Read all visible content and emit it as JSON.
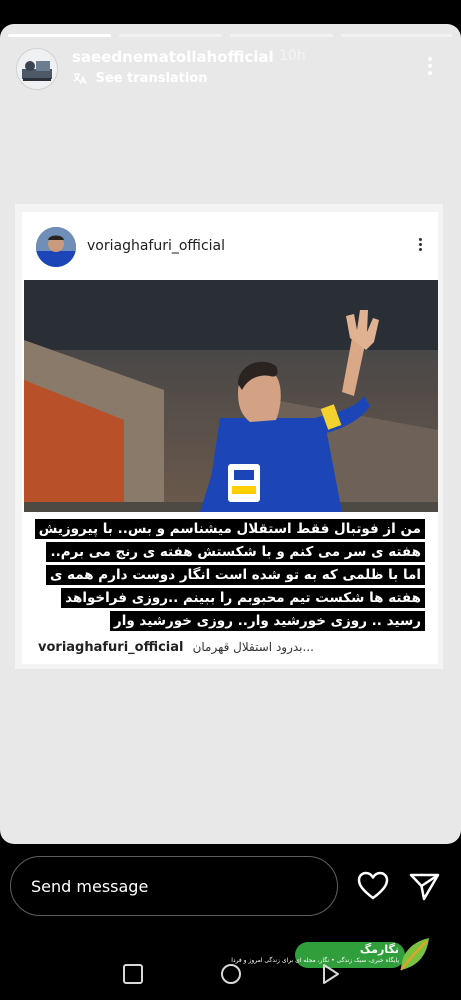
{
  "story": {
    "author": "saeednematollahofficial",
    "time": "10h",
    "translation_link": "See translation",
    "progress_segments": [
      {
        "state": "seen"
      },
      {
        "state": "unseen"
      },
      {
        "state": "unseen"
      },
      {
        "state": "unseen"
      }
    ]
  },
  "post": {
    "username": "voriaghafuri_official",
    "caption_lines": [
      "من از فوتبال فقط استقلال میشناسم و بس.. با پیروزیش",
      "هفته ی سر می کنم و با شکستش هفته ی رنج می برم..",
      "اما با ظلمی که به تو شده است انگار دوست دارم همه ی",
      "هفته ها شکست تیم محبوبم را ببینم ..روزی فراخواهد",
      "رسید .. روزی خورشید وار.. روزی خورشید وار"
    ],
    "footer_username": "voriaghafuri_official",
    "footer_caption": "بدرود استقلال قهرمان..."
  },
  "reply": {
    "placeholder": "Send message"
  },
  "watermark": {
    "name": "نگارمگ",
    "tagline": "پایگاه خبری، سبک زندگی • نگار، مجله ای برای زندگی امروز و فردا"
  },
  "icons": {
    "story_menu": "more-vertical-icon",
    "post_menu": "more-vertical-icon",
    "translation": "translate-icon",
    "heart": "heart-icon",
    "send": "send-icon",
    "nav_recents": "square-icon",
    "nav_home": "circle-icon",
    "nav_back": "triangle-icon"
  },
  "colors": {
    "story_background": "#e8e8e8",
    "jersey_blue": "#1c46b8",
    "watermark_green": "#2f9e3b"
  }
}
